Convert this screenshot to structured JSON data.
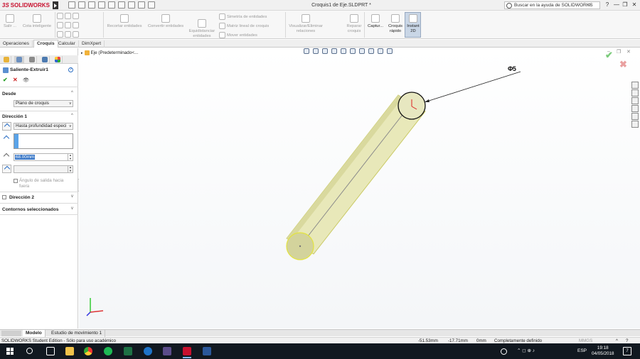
{
  "titlebar": {
    "app_logo": "SOLIDWORKS",
    "logo_prefix": "3S",
    "document_title": "Croquis1 de Eje.SLDPRT *",
    "help_search_placeholder": "Buscar en la ayuda de SOLIDWORKS",
    "minimize": "—",
    "restore": "❐",
    "close": "✕",
    "help_glyph": "?"
  },
  "ribbon": {
    "salir": "Salir ...",
    "cota_inteligente": "Cota inteligente",
    "recortar": "Recortar entidades",
    "convertir": "Convertir entidades",
    "equidistanciar": "Equidistanciar entidades",
    "simetria": "Simetría de entidades",
    "matriz": "Matriz lineal de croquis",
    "mover": "Mover entidades",
    "visualizar": "Visualizar/Eliminar relaciones",
    "reparar": "Reparar croquis",
    "captura": "Captur...",
    "croquis_rapido": "Croquis rápido",
    "instant2d": "Instant 2D"
  },
  "tabs": [
    "Operaciones",
    "Croquis",
    "Calcular",
    "DimXpert"
  ],
  "active_tab": "Croquis",
  "property_manager": {
    "title": "Saliente-Extruir1",
    "ok": "✔",
    "cancel": "✕",
    "preview": "👁",
    "desde_label": "Desde",
    "desde_value": "Plano de croquis",
    "direccion1_label": "Dirección 1",
    "direccion1_type": "Hasta profundidad especi",
    "depth_value": "68.00mm",
    "draft_label_line1": "Ángulo de salida hacia",
    "draft_label_line2": "fuera",
    "direccion2_label": "Dirección 2",
    "contornos_label": "Contornos seleccionados",
    "collapse_glyph": "^",
    "expand_glyph": "v",
    "help_glyph": "?",
    "dropdown_glyph": "v"
  },
  "viewport": {
    "tree_item": "Eje  (Predeterminado<...",
    "dimension_label": "Φ5",
    "confirm": "✔",
    "reject": "✖",
    "tree_expand": "▸",
    "heads_up_count": 10
  },
  "model_tabs": [
    "Modelo",
    "Estudio de movimiento 1"
  ],
  "statusbar": {
    "edition": "SOLIDWORKS Student Edition - Sólo para uso académico",
    "x": "-51.53mm",
    "y": "-17.71mm",
    "z": "0mm",
    "state": "Completamente definido",
    "units": "MMGS",
    "units_arrow": "^",
    "help_glyph": "?"
  },
  "taskbar": {
    "time": "19:18",
    "date": "04/05/2018",
    "language": "ESP",
    "notification_count": "7",
    "tray_icons": "⌃  ◻  ⊕  ♪"
  },
  "colors": {
    "accent_red": "#c8102e",
    "cylinder_fill": "#e8e8b9",
    "cylinder_edge": "#c9c964",
    "selection_blue": "#3a78c8"
  }
}
